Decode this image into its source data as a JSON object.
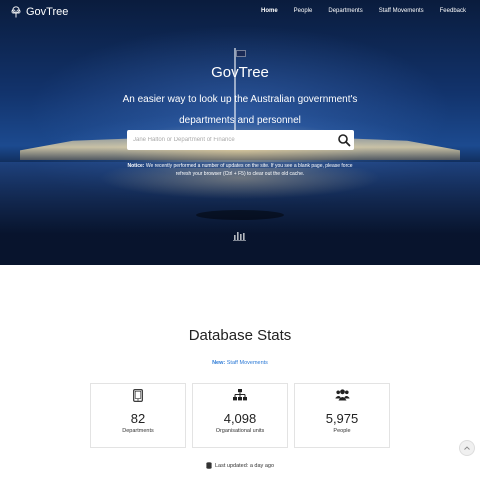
{
  "nav": {
    "brand": "GovTree",
    "links": [
      "Home",
      "People",
      "Departments",
      "Staff Movements",
      "Feedback"
    ]
  },
  "hero": {
    "title": "GovTree",
    "subtitle": "An easier way to look up the Australian government's departments and personnel",
    "search_placeholder": "Jane Halton or Department of Finance",
    "notice_label": "Notice:",
    "notice_text": "We recently performed a number of updates on the site. If you see a blank page, please force refresh your browser (Ctrl + F5) to clear out the old cache."
  },
  "stats": {
    "title": "Database Stats",
    "new_label": "New:",
    "new_link": "Staff Movements",
    "cards": [
      {
        "icon": "tablet-icon",
        "value": "82",
        "label": "Departments"
      },
      {
        "icon": "sitemap-icon",
        "value": "4,098",
        "label": "Organisational units"
      },
      {
        "icon": "users-icon",
        "value": "5,975",
        "label": "People"
      }
    ],
    "last_updated": "Last updated: a day ago"
  },
  "colors": {
    "accent": "#2c7ad6",
    "hero_dark": "#0a1c3d"
  }
}
